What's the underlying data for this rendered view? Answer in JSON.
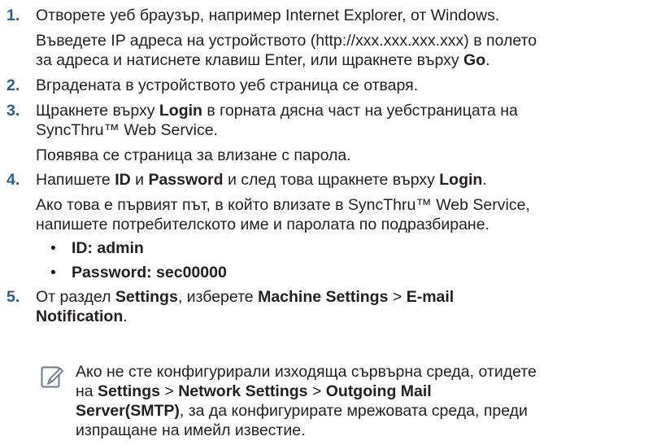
{
  "steps": [
    {
      "number": "1.",
      "lines": [
        "Отворете уеб браузър, например Internet Explorer, от Windows.",
        "Въведете IP адреса на устройството (http://xxx.xxx.xxx.xxx) в полето",
        "за адреса и натиснете клавиш Enter, или щракнете върху "
      ],
      "go": "Go",
      "period": "."
    },
    {
      "number": "2.",
      "line": "Вградената в устройството уеб страница се отваря."
    },
    {
      "number": "3.",
      "line1_pre": "Щракнете върху ",
      "line1_bold": "Login",
      "line1_post": " в горната дясна част на уебстраницата на",
      "line2": "SyncThru™ Web Service.",
      "line3": "Появява се страница за влизане с парола."
    },
    {
      "number": "4.",
      "line1_a": "Напишете ",
      "line1_id": "ID",
      "line1_b": " и ",
      "line1_pw": "Password",
      "line1_c": " и след това щракнете върху ",
      "line1_login": "Login",
      "line1_d": ".",
      "line2": "Ако това е първият път, в който влизате в SyncThru™ Web Service,",
      "line3": "напишете потребителското име и паролата по подразбиране.",
      "bullet_mark": "•",
      "bullets": [
        "ID: admin",
        "Password: sec00000"
      ]
    },
    {
      "number": "5.",
      "line1_a": "От раздел ",
      "line1_settings": "Settings",
      "line1_b": ", изберете ",
      "line1_machine": "Machine Settings",
      "line1_c": " > ",
      "line1_email": "E-mail",
      "line2_bold": "Notification",
      "line2_post": "."
    }
  ],
  "note": {
    "line1": "Ако не сте конфигурирали изходяща сървърна среда, отидете",
    "line2_a": "на ",
    "line2_settings": "Settings",
    "line2_b": " > ",
    "line2_network": "Network Settings",
    "line2_c": " > ",
    "line2_outgoing": "Outgoing Mail",
    "line3_bold": "Server(SMTP)",
    "line3_post": ", за да конфигурирате мрежовата среда, преди",
    "line4": "изпращане на имейл известие."
  },
  "colors": {
    "step_number": "#2e5f8c",
    "text": "#231f20"
  }
}
